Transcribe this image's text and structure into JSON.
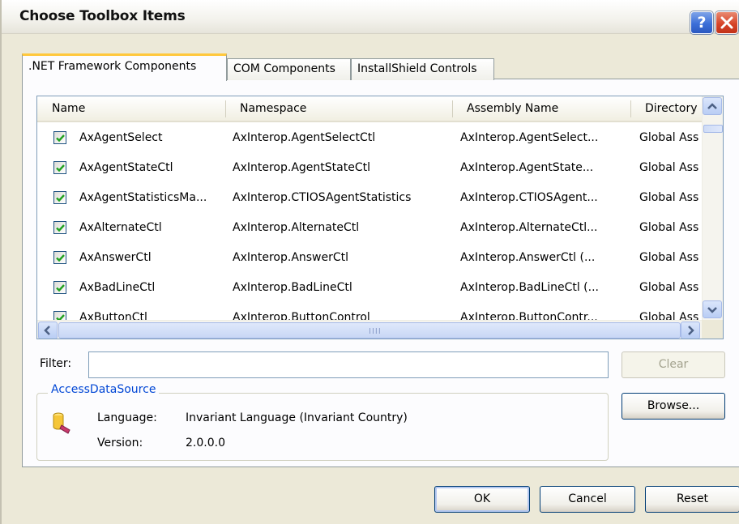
{
  "window": {
    "title": "Choose Toolbox Items",
    "help_glyph": "?",
    "close_glyph": "X"
  },
  "tabs": [
    {
      "label": ".NET Framework Components",
      "active": true
    },
    {
      "label": "COM Components",
      "active": false
    },
    {
      "label": "InstallShield Controls",
      "active": false
    }
  ],
  "list": {
    "columns": [
      "Name",
      "Namespace",
      "Assembly Name",
      "Directory"
    ],
    "rows": [
      {
        "checked": true,
        "name": "AxAgentSelect",
        "namespace": "AxInterop.AgentSelectCtl",
        "assembly": "AxInterop.AgentSelect...",
        "directory": "Global Ass"
      },
      {
        "checked": true,
        "name": "AxAgentStateCtl",
        "namespace": "AxInterop.AgentStateCtl",
        "assembly": "AxInterop.AgentState...",
        "directory": "Global Ass"
      },
      {
        "checked": true,
        "name": "AxAgentStatisticsMa...",
        "namespace": "AxInterop.CTIOSAgentStatistics",
        "assembly": "AxInterop.CTIOSAgent...",
        "directory": "Global Ass"
      },
      {
        "checked": true,
        "name": "AxAlternateCtl",
        "namespace": "AxInterop.AlternateCtl",
        "assembly": "AxInterop.AlternateCtl...",
        "directory": "Global Ass"
      },
      {
        "checked": true,
        "name": "AxAnswerCtl",
        "namespace": "AxInterop.AnswerCtl",
        "assembly": "AxInterop.AnswerCtl (...",
        "directory": "Global Ass"
      },
      {
        "checked": true,
        "name": "AxBadLineCtl",
        "namespace": "AxInterop.BadLineCtl",
        "assembly": "AxInterop.BadLineCtl (...",
        "directory": "Global Ass"
      },
      {
        "checked": true,
        "name": "AxButtonCtl",
        "namespace": "AxInterop.ButtonControl",
        "assembly": "AxInterop.ButtonContr...",
        "directory": "Global Ass"
      }
    ]
  },
  "filter": {
    "label": "Filter:",
    "value": "",
    "clear_label": "Clear"
  },
  "details": {
    "group_title": "AccessDataSource",
    "language_label": "Language:",
    "language_value": "Invariant Language (Invariant Country)",
    "version_label": "Version:",
    "version_value": "2.0.0.0"
  },
  "buttons": {
    "browse": "Browse...",
    "ok": "OK",
    "cancel": "Cancel",
    "reset": "Reset"
  },
  "colors": {
    "window_bg": "#ece9d8",
    "panel_bg": "#fcfcfe",
    "tab_highlight": "#ffc83c",
    "group_title": "#0046d5",
    "checkmark": "#21a121"
  }
}
